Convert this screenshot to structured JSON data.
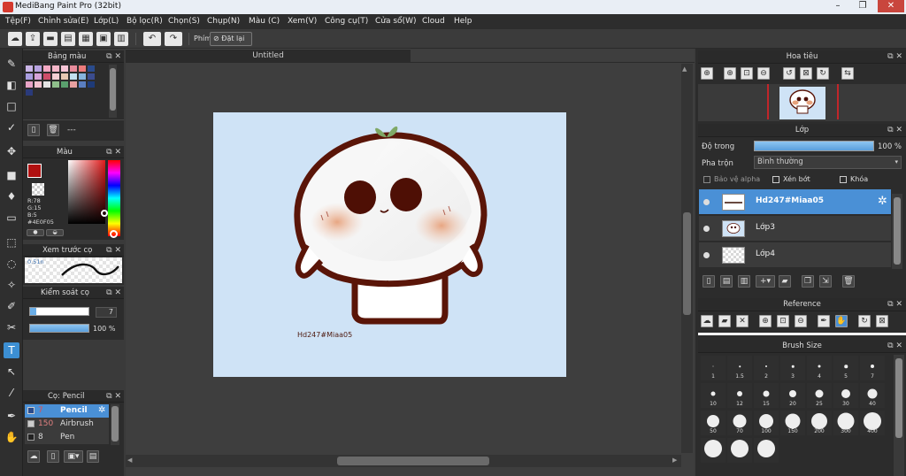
{
  "window": {
    "title": "MediBang Paint Pro (32bit)",
    "controls": [
      "–",
      "❐",
      "✕"
    ]
  },
  "menu": [
    "Tệp(F)",
    "Chỉnh sửa(E)",
    "Lớp(L)",
    "Bộ lọc(R)",
    "Chọn(S)",
    "Chụp(N)",
    "Màu (C)",
    "Xem(V)",
    "Công cụ(T)",
    "Cửa sổ(W)",
    "Cloud",
    "Help"
  ],
  "toolbar": {
    "key_label": "Phím",
    "reset_label": "Đặt lại"
  },
  "document": {
    "tab": "Untitled",
    "caption": "Hd247#Miaa05"
  },
  "palette_panel": {
    "title": "Bảng màu",
    "footer": "---"
  },
  "color_panel": {
    "title": "Màu",
    "r": "R:78",
    "g": "G:15",
    "b": "B:5",
    "hex": "#4E0F05",
    "fg_color": "#b01010"
  },
  "brush_preview_panel": {
    "title": "Xem trước cọ",
    "size_text": "0.51n"
  },
  "brush_control_panel": {
    "title": "Kiểm soát cọ",
    "size_value": "7",
    "opacity_value": "100 %"
  },
  "brush_list_panel": {
    "title": "Cọ: Pencil",
    "items": [
      {
        "size": "7",
        "name": "Pencil",
        "selected": true
      },
      {
        "size": "150",
        "name": "Airbrush",
        "selected": false
      },
      {
        "size": "8",
        "name": "Pen",
        "selected": false
      }
    ]
  },
  "navigator_panel": {
    "title": "Hoa tiêu"
  },
  "layer_panel": {
    "title": "Lớp",
    "opacity_label": "Độ trong",
    "opacity_value": "100 %",
    "blend_label": "Pha trộn",
    "blend_value": "Bình thường",
    "protect_alpha": "Bảo vệ alpha",
    "clipping": "Xén bớt",
    "lock": "Khóa",
    "layers": [
      {
        "name": "Hd247#Miaa05",
        "selected": true
      },
      {
        "name": "Lớp3",
        "selected": false
      },
      {
        "name": "Lớp4",
        "selected": false
      }
    ]
  },
  "reference_panel": {
    "title": "Reference"
  },
  "brush_size_panel": {
    "title": "Brush Size",
    "sizes": [
      "1",
      "1.5",
      "2",
      "3",
      "4",
      "5",
      "7",
      "10",
      "12",
      "15",
      "20",
      "25",
      "30",
      "40",
      "50",
      "70",
      "100",
      "150",
      "200",
      "300",
      "400",
      "",
      "",
      ""
    ]
  }
}
